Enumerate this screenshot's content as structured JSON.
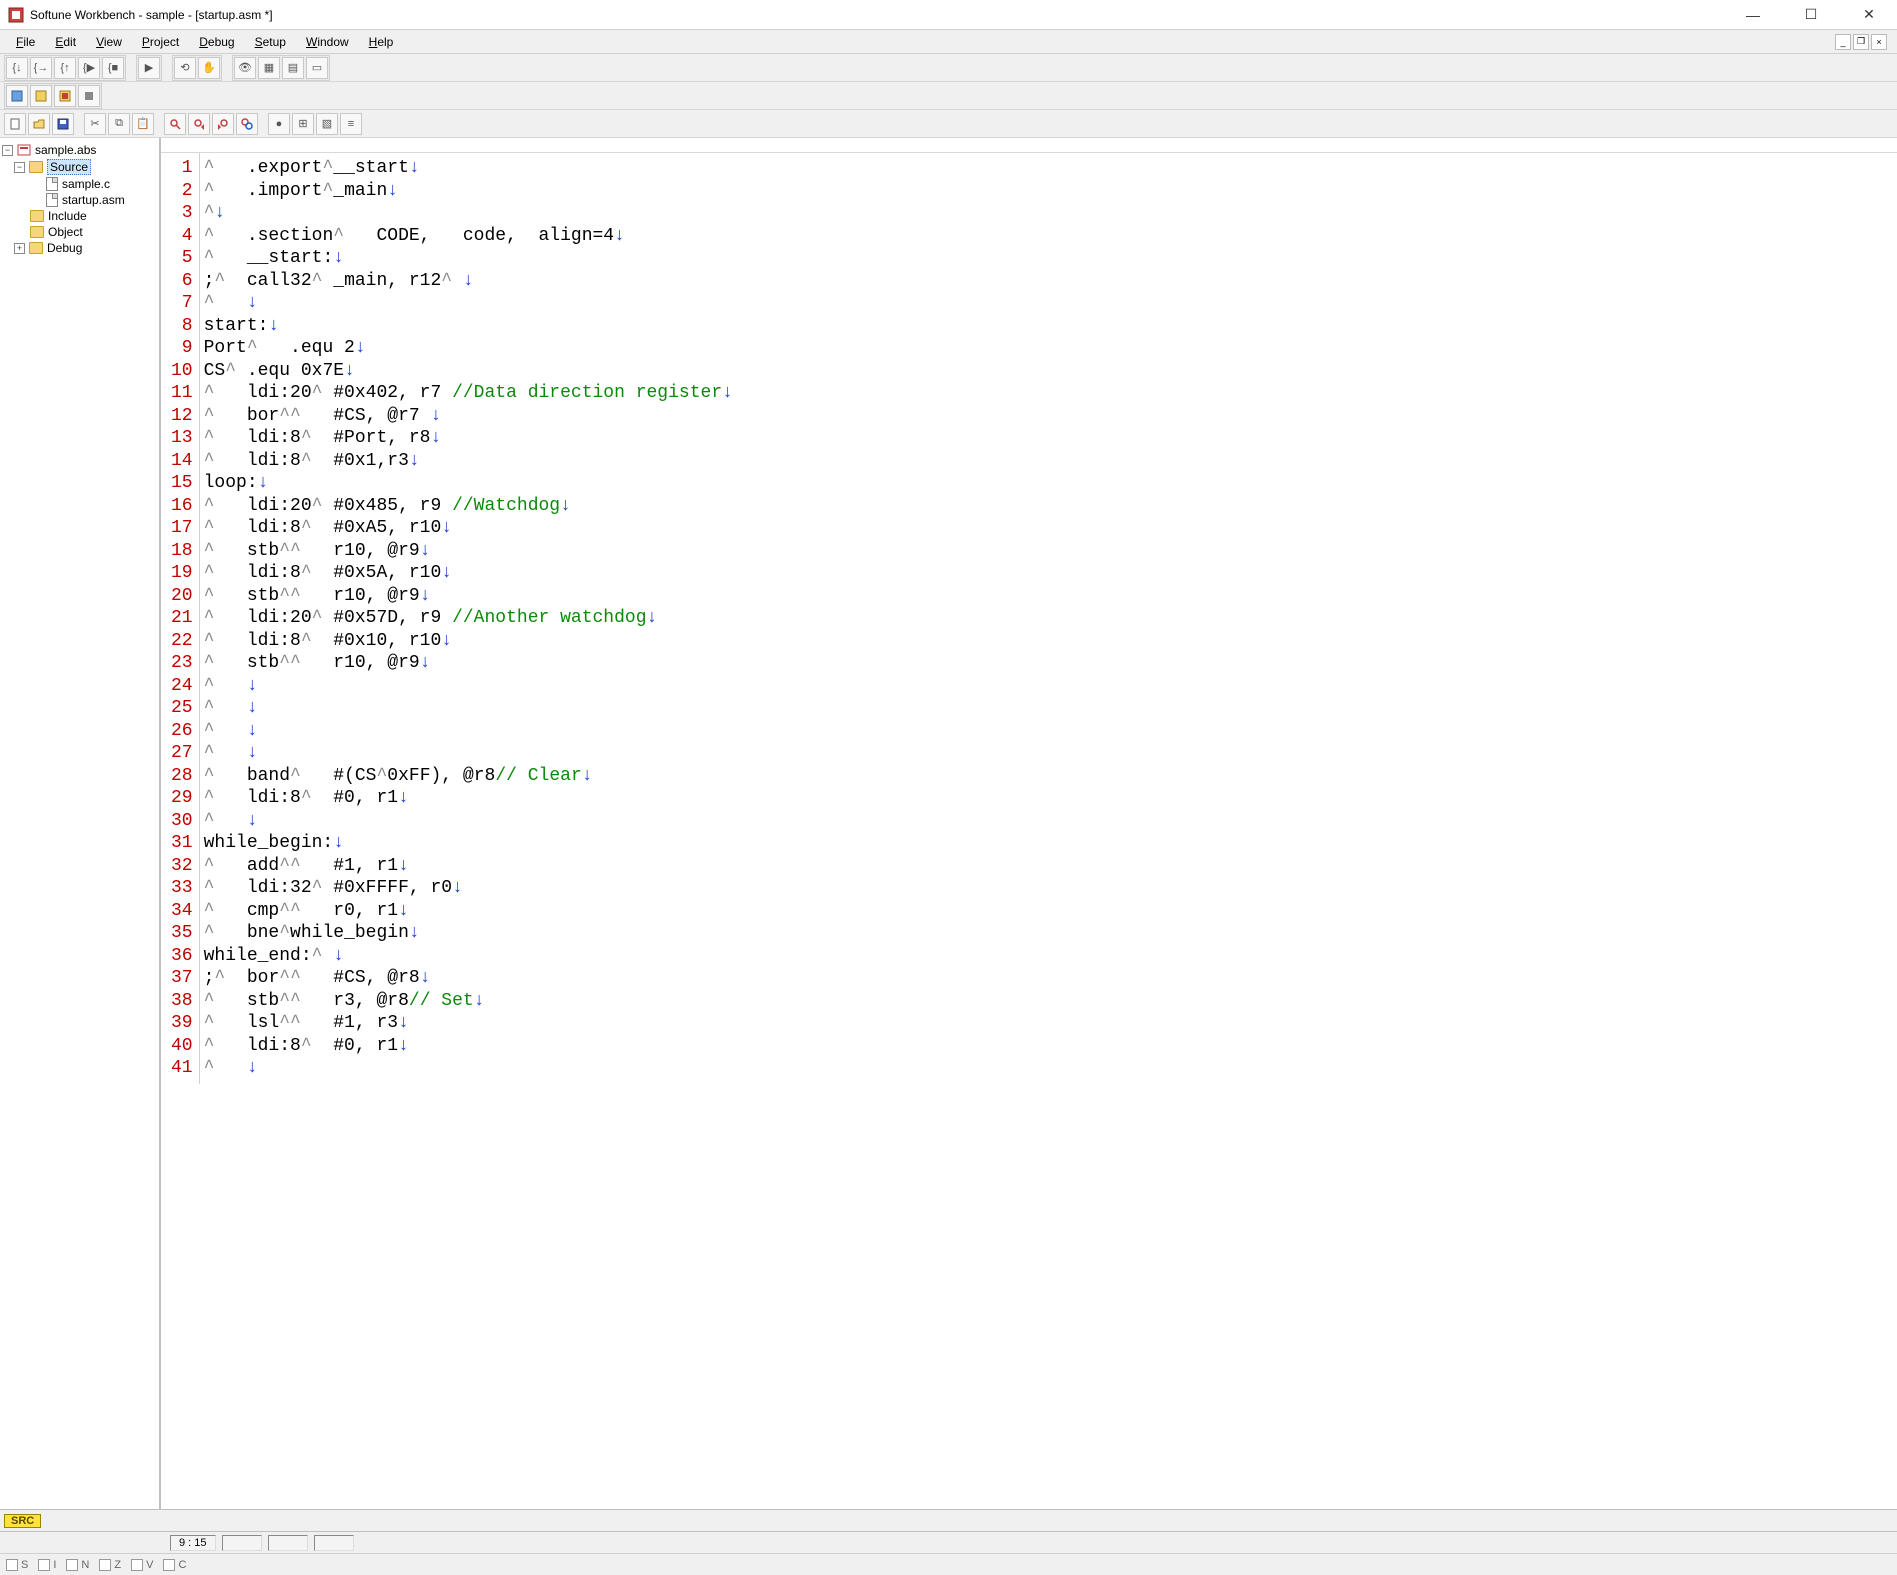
{
  "window": {
    "title": "Softune Workbench - sample - [startup.asm *]"
  },
  "menu": {
    "file": "File",
    "edit": "Edit",
    "view": "View",
    "project": "Project",
    "debug": "Debug",
    "setup": "Setup",
    "window": "Window",
    "help": "Help"
  },
  "project_tree": {
    "root": "sample.abs",
    "source_folder": "Source",
    "source_files": [
      "sample.c",
      "startup.asm"
    ],
    "include_folder": "Include",
    "object_folder": "Object",
    "debug_folder": "Debug"
  },
  "editor": {
    "lines": [
      {
        "n": 1,
        "pre": "^   ",
        "text": ".export^__start",
        "nl": "↓",
        "comment": ""
      },
      {
        "n": 2,
        "pre": "^   ",
        "text": ".import^_main",
        "nl": "↓",
        "comment": ""
      },
      {
        "n": 3,
        "pre": "^",
        "text": "",
        "nl": "↓",
        "comment": ""
      },
      {
        "n": 4,
        "pre": "^   ",
        "text": ".section^   CODE,   code,  align=4",
        "nl": "↓",
        "comment": ""
      },
      {
        "n": 5,
        "pre": "^   ",
        "text": "__start:",
        "nl": "↓",
        "comment": ""
      },
      {
        "n": 6,
        "pre": ";^  ",
        "text": "call32^ _main, r12^ ",
        "nl": "↓",
        "comment": ""
      },
      {
        "n": 7,
        "pre": "^   ",
        "text": "",
        "nl": "↓",
        "comment": ""
      },
      {
        "n": 8,
        "pre": "",
        "text": "start:",
        "nl": "↓",
        "comment": ""
      },
      {
        "n": 9,
        "pre": "",
        "text": "Port^   .equ 2",
        "nl": "↓",
        "comment": ""
      },
      {
        "n": 10,
        "pre": "",
        "text": "CS^ .equ 0x7E",
        "nl": "↓",
        "comment": ""
      },
      {
        "n": 11,
        "pre": "^   ",
        "text": "ldi:20^ #0x402, r7 ",
        "nl": "↓",
        "comment": "//Data direction register"
      },
      {
        "n": 12,
        "pre": "^   ",
        "text": "bor^^   #CS, @r7 ",
        "nl": "↓",
        "comment": ""
      },
      {
        "n": 13,
        "pre": "^   ",
        "text": "ldi:8^  #Port, r8",
        "nl": "↓",
        "comment": ""
      },
      {
        "n": 14,
        "pre": "^   ",
        "text": "ldi:8^  #0x1,r3",
        "nl": "↓",
        "comment": ""
      },
      {
        "n": 15,
        "pre": "",
        "text": "loop:",
        "nl": "↓",
        "comment": ""
      },
      {
        "n": 16,
        "pre": "^   ",
        "text": "ldi:20^ #0x485, r9 ",
        "nl": "↓",
        "comment": "//Watchdog"
      },
      {
        "n": 17,
        "pre": "^   ",
        "text": "ldi:8^  #0xA5, r10",
        "nl": "↓",
        "comment": ""
      },
      {
        "n": 18,
        "pre": "^   ",
        "text": "stb^^   r10, @r9",
        "nl": "↓",
        "comment": ""
      },
      {
        "n": 19,
        "pre": "^   ",
        "text": "ldi:8^  #0x5A, r10",
        "nl": "↓",
        "comment": ""
      },
      {
        "n": 20,
        "pre": "^   ",
        "text": "stb^^   r10, @r9",
        "nl": "↓",
        "comment": ""
      },
      {
        "n": 21,
        "pre": "^   ",
        "text": "ldi:20^ #0x57D, r9 ",
        "nl": "↓",
        "comment": "//Another watchdog"
      },
      {
        "n": 22,
        "pre": "^   ",
        "text": "ldi:8^  #0x10, r10",
        "nl": "↓",
        "comment": ""
      },
      {
        "n": 23,
        "pre": "^   ",
        "text": "stb^^   r10, @r9",
        "nl": "↓",
        "comment": ""
      },
      {
        "n": 24,
        "pre": "^   ",
        "text": "",
        "nl": "↓",
        "comment": ""
      },
      {
        "n": 25,
        "pre": "^   ",
        "text": "",
        "nl": "↓",
        "comment": ""
      },
      {
        "n": 26,
        "pre": "^   ",
        "text": "",
        "nl": "↓",
        "comment": ""
      },
      {
        "n": 27,
        "pre": "^   ",
        "text": "",
        "nl": "↓",
        "comment": ""
      },
      {
        "n": 28,
        "pre": "^   ",
        "text": "band^   #(CS^0xFF), @r8",
        "nl": "↓",
        "comment": "// Clear"
      },
      {
        "n": 29,
        "pre": "^   ",
        "text": "ldi:8^  #0, r1",
        "nl": "↓",
        "comment": ""
      },
      {
        "n": 30,
        "pre": "^   ",
        "text": "",
        "nl": "↓",
        "comment": ""
      },
      {
        "n": 31,
        "pre": "",
        "text": "while_begin:",
        "nl": "↓",
        "comment": ""
      },
      {
        "n": 32,
        "pre": "^   ",
        "text": "add^^   #1, r1",
        "nl": "↓",
        "comment": ""
      },
      {
        "n": 33,
        "pre": "^   ",
        "text": "ldi:32^ #0xFFFF, r0",
        "nl": "↓",
        "comment": ""
      },
      {
        "n": 34,
        "pre": "^   ",
        "text": "cmp^^   r0, r1",
        "nl": "↓",
        "comment": ""
      },
      {
        "n": 35,
        "pre": "^   ",
        "text": "bne^while_begin",
        "nl": "↓",
        "comment": ""
      },
      {
        "n": 36,
        "pre": "",
        "text": "while_end:^ ",
        "nl": "↓",
        "comment": ""
      },
      {
        "n": 37,
        "pre": ";^  ",
        "text": "bor^^   #CS, @r8",
        "nl": "↓",
        "comment": ""
      },
      {
        "n": 38,
        "pre": "^   ",
        "text": "stb^^   r3, @r8",
        "nl": "↓",
        "comment": "// Set"
      },
      {
        "n": 39,
        "pre": "^   ",
        "text": "lsl^^   #1, r3",
        "nl": "↓",
        "comment": ""
      },
      {
        "n": 40,
        "pre": "^   ",
        "text": "ldi:8^  #0, r1",
        "nl": "↓",
        "comment": ""
      },
      {
        "n": 41,
        "pre": "^   ",
        "text": "",
        "nl": "↓",
        "comment": ""
      }
    ]
  },
  "status": {
    "cursor": "9 : 15",
    "flags": [
      "S",
      "I",
      "N",
      "Z",
      "V",
      "C"
    ]
  },
  "bottom_tab": "SRC"
}
